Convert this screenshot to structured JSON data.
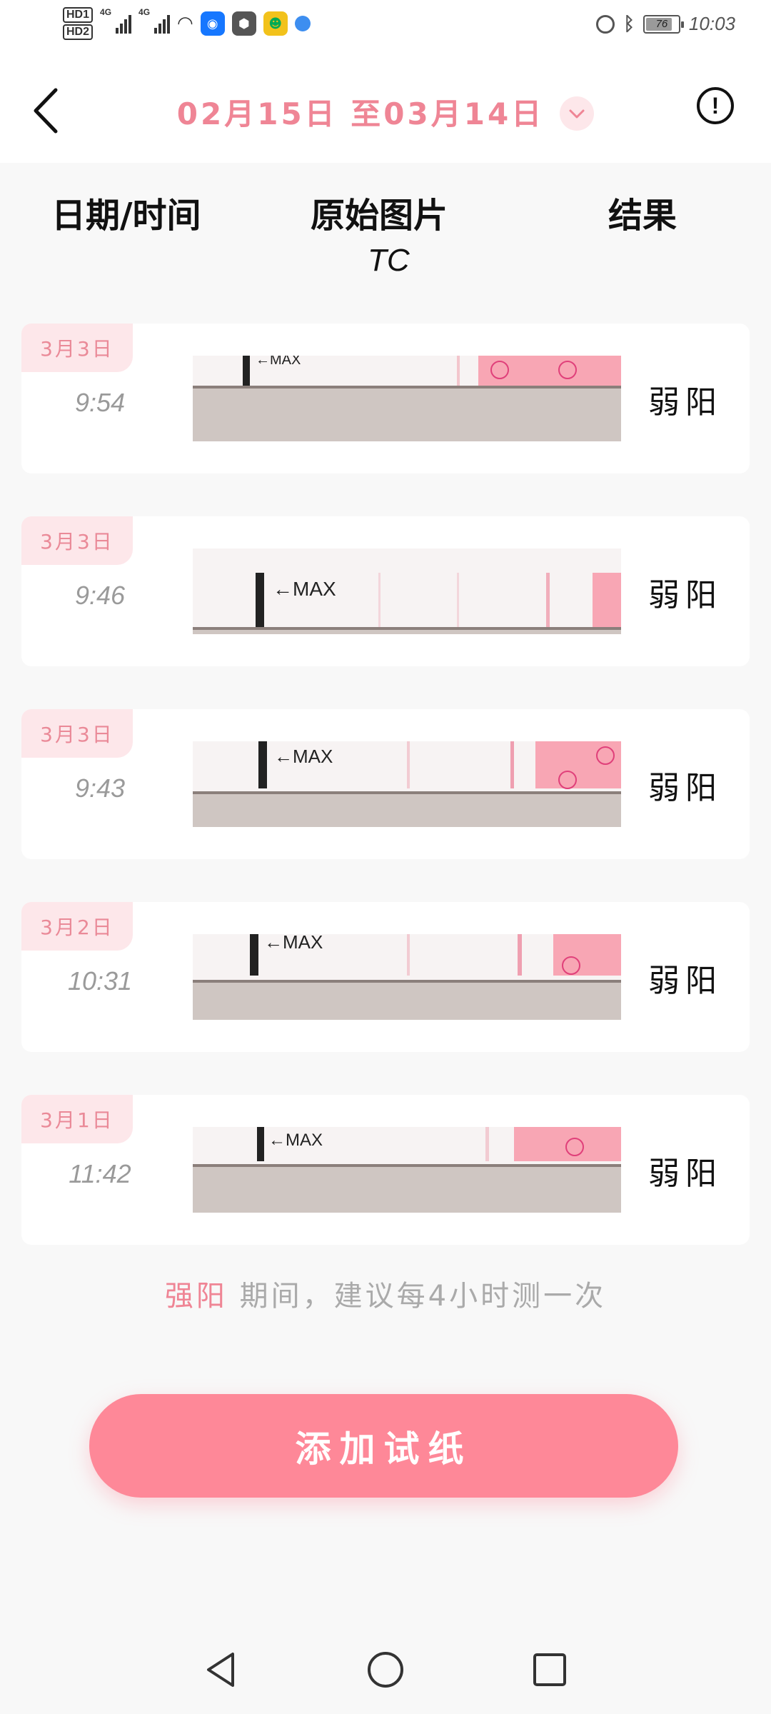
{
  "status_bar": {
    "hd1": "HD1",
    "hd2": "HD2",
    "net1": "4G",
    "net2": "4G",
    "battery": "76",
    "time": "10:03",
    "icons": [
      "wifi-icon",
      "app-icon",
      "shield-icon",
      "app-icon",
      "globe-icon",
      "alarm-icon",
      "bluetooth-icon",
      "battery-icon"
    ]
  },
  "header": {
    "date_range": "02月15日 至03月14日",
    "back_icon": "back-arrow-icon",
    "dropdown_icon": "chevron-down-icon",
    "info_icon": "info-icon"
  },
  "columns": {
    "date_time": "日期/时间",
    "image": "原始图片",
    "result": "结果",
    "tc": "TC"
  },
  "records": [
    {
      "date": "3月3日",
      "time": "9:54",
      "result": "弱阳"
    },
    {
      "date": "3月3日",
      "time": "9:46",
      "result": "弱阳"
    },
    {
      "date": "3月3日",
      "time": "9:43",
      "result": "弱阳"
    },
    {
      "date": "3月2日",
      "time": "10:31",
      "result": "弱阳"
    },
    {
      "date": "3月1日",
      "time": "11:42",
      "result": "弱阳"
    }
  ],
  "strip_label": "←MAX",
  "hint": {
    "highlight": "强阳",
    "text": " 期间，建议每4小时测一次"
  },
  "add_button": "添加试纸",
  "colors": {
    "accent": "#fe8898",
    "accent_text": "#ef8595",
    "tag_bg": "#fde7ea"
  }
}
